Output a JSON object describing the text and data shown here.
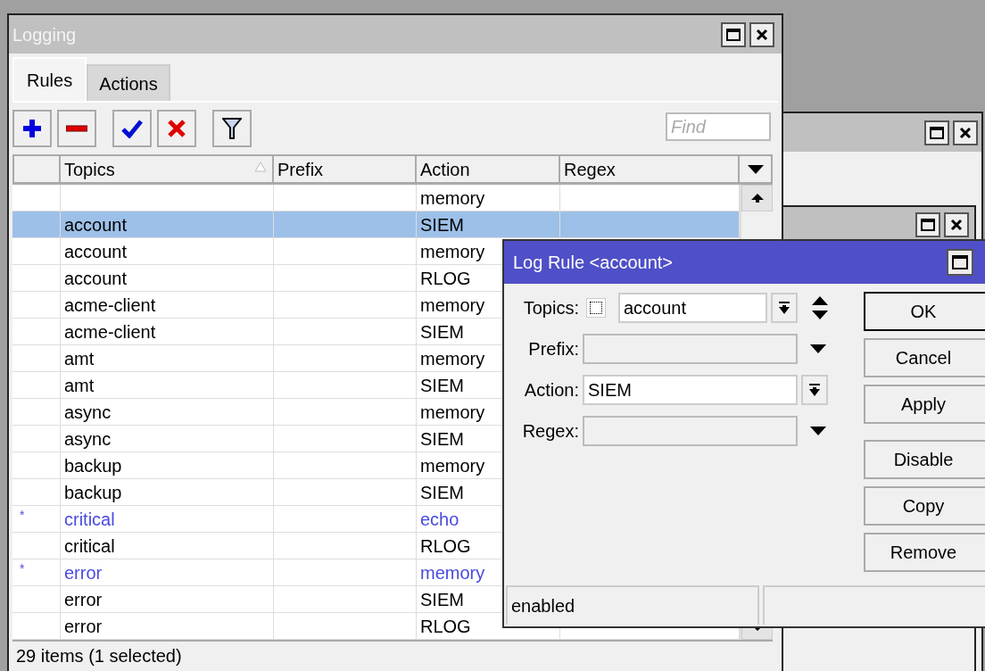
{
  "window": {
    "title": "Logging"
  },
  "tabs": [
    {
      "label": "Rules",
      "selected": true
    },
    {
      "label": "Actions",
      "selected": false
    }
  ],
  "search": {
    "placeholder": "Find"
  },
  "table": {
    "columns": [
      {
        "label": "Topics",
        "sorted": true
      },
      {
        "label": "Prefix",
        "sorted": false
      },
      {
        "label": "Action",
        "sorted": false
      },
      {
        "label": "Regex",
        "sorted": false
      }
    ],
    "rows": [
      {
        "action": "memory",
        "selected": false,
        "default": false
      },
      {
        "topics": "account",
        "action": "SIEM",
        "selected": true,
        "default": false
      },
      {
        "topics": "account",
        "action": "memory",
        "selected": false,
        "default": false
      },
      {
        "topics": "account",
        "action": "RLOG",
        "selected": false,
        "default": false
      },
      {
        "topics": "acme-client",
        "action": "memory",
        "selected": false,
        "default": false
      },
      {
        "topics": "acme-client",
        "action": "SIEM",
        "selected": false,
        "default": false
      },
      {
        "topics": "amt",
        "action": "memory",
        "selected": false,
        "default": false
      },
      {
        "topics": "amt",
        "action": "SIEM",
        "selected": false,
        "default": false
      },
      {
        "topics": "async",
        "action": "memory",
        "selected": false,
        "default": false
      },
      {
        "topics": "async",
        "action": "SIEM",
        "selected": false,
        "default": false
      },
      {
        "topics": "backup",
        "action": "memory",
        "selected": false,
        "default": false
      },
      {
        "topics": "backup",
        "action": "SIEM",
        "selected": false,
        "default": false
      },
      {
        "flag": "*",
        "topics": "critical",
        "action": "echo",
        "selected": false,
        "default": true
      },
      {
        "topics": "critical",
        "action": "RLOG",
        "selected": false,
        "default": false
      },
      {
        "flag": "*",
        "topics": "error",
        "action": "memory",
        "selected": false,
        "default": true
      },
      {
        "topics": "error",
        "action": "SIEM",
        "selected": false,
        "default": false
      },
      {
        "topics": "error",
        "action": "RLOG",
        "selected": false,
        "default": false
      }
    ]
  },
  "status_bar": "29 items (1 selected)",
  "dialog": {
    "title": "Log Rule <account>",
    "fields": [
      {
        "kind": "topics",
        "label": "Topics:",
        "value": "account",
        "checked": false
      },
      {
        "kind": "combo",
        "label": "Prefix:"
      },
      {
        "kind": "select",
        "label": "Action:",
        "value": "SIEM"
      },
      {
        "kind": "combo",
        "label": "Regex:"
      }
    ],
    "button_groups": [
      [
        {
          "label": "OK",
          "default": true
        },
        {
          "label": "Cancel",
          "default": false
        },
        {
          "label": "Apply",
          "default": false
        }
      ],
      [
        {
          "label": "Disable",
          "default": false
        },
        {
          "label": "Copy",
          "default": false
        },
        {
          "label": "Remove",
          "default": false
        }
      ]
    ],
    "status": "enabled"
  }
}
